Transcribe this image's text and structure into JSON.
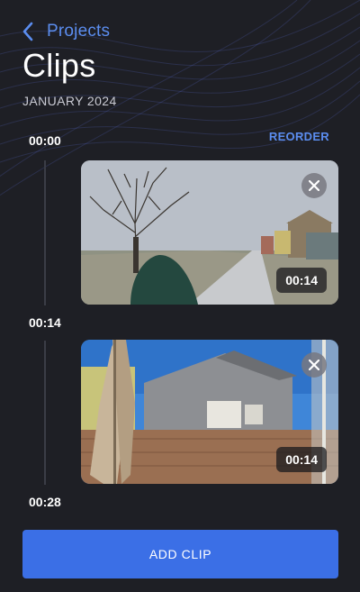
{
  "nav": {
    "back_label": "Projects"
  },
  "header": {
    "title": "Clips",
    "subtitle": "JANUARY 2024"
  },
  "toolbar": {
    "reorder_label": "REORDER"
  },
  "timeline": {
    "markers": [
      "00:00",
      "00:14",
      "00:28"
    ]
  },
  "clips": [
    {
      "duration": "00:14",
      "remove_icon": "close-icon",
      "scene": "icy tree, street and houses"
    },
    {
      "duration": "00:14",
      "remove_icon": "close-icon",
      "scene": "patio umbrella, fence and house"
    }
  ],
  "footer": {
    "add_label": "ADD CLIP"
  },
  "colors": {
    "background": "#1e1f25",
    "accent": "#5b8def",
    "button": "#3b6fe6"
  }
}
